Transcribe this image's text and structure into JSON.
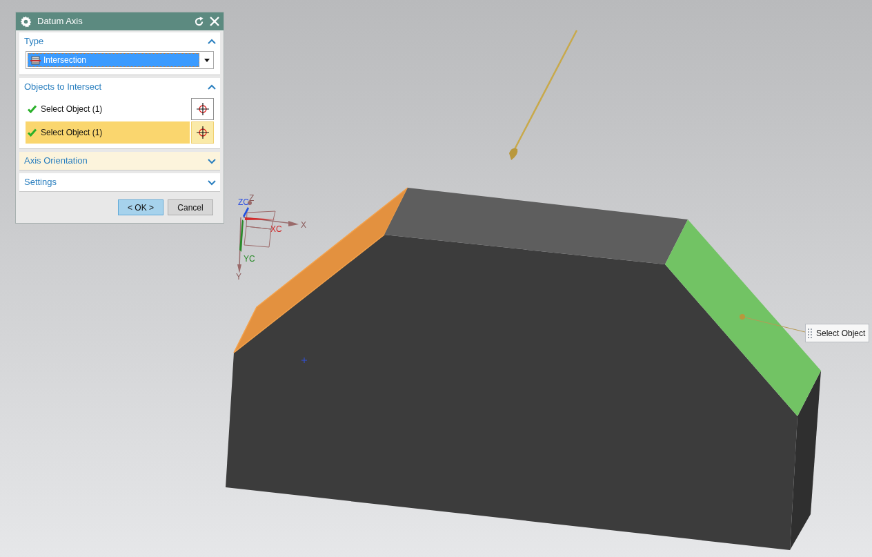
{
  "dialog": {
    "title": "Datum Axis",
    "sections": [
      {
        "kind": "type",
        "title": "Type",
        "expanded": true,
        "highlighted": false,
        "dropdown": {
          "value": "Intersection"
        }
      },
      {
        "kind": "selection",
        "title": "Objects to Intersect",
        "expanded": true,
        "highlighted": false,
        "rows": [
          {
            "label": "Select Object (1)",
            "checked": true,
            "selected": false
          },
          {
            "label": "Select Object (1)",
            "checked": true,
            "selected": true
          }
        ]
      },
      {
        "title": "Axis Orientation",
        "expanded": false,
        "highlighted": true
      },
      {
        "title": "Settings",
        "expanded": false,
        "highlighted": false
      }
    ],
    "buttons": [
      {
        "label": "< OK >",
        "selected": true
      },
      {
        "label": "Cancel",
        "selected": false
      }
    ]
  },
  "viewport": {
    "triad": {
      "zc": "ZC",
      "z": "Z",
      "xc": "XC",
      "x": "X",
      "yc": "YC",
      "y": "Y"
    },
    "tooltip": "Select Object"
  }
}
